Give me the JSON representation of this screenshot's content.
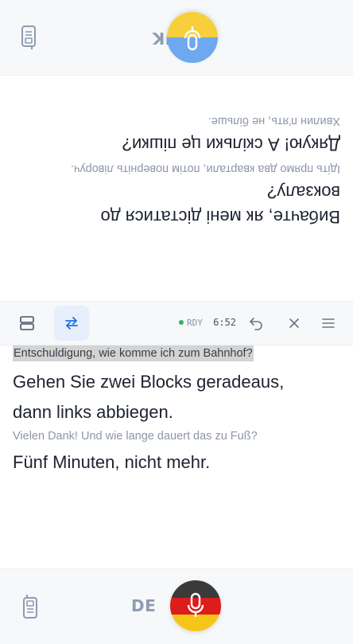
{
  "top_panel": {
    "language_code": "UK",
    "lines": [
      {
        "text": "Вибачте, як мені дістатися до",
        "style": "big"
      },
      {
        "text": "вокзалу?",
        "style": "big"
      },
      {
        "text": "Ідіть прямо два квартали, потім поверніть ліворуч.",
        "style": "small"
      },
      {
        "text": "Дякую! А скільки це пішки?",
        "style": "big"
      },
      {
        "text": "Хвилин п'ять, не більше.",
        "style": "small"
      }
    ],
    "icons": {
      "mic": "mic-icon",
      "device": "walkie-talkie-icon"
    },
    "flag_colors": [
      "#0057b7",
      "#ffd700"
    ]
  },
  "toolbar": {
    "status_label": "RDY",
    "time": "6:52",
    "status_color": "#2fb36b",
    "icons": [
      "layout-split-icon",
      "swap-icon",
      "undo-icon",
      "close-icon",
      "menu-icon"
    ]
  },
  "bottom_panel": {
    "language_code": "DE",
    "lines": [
      {
        "text": "Entschuldigung, wie komme ich zum Bahnhof?",
        "style": "highlight"
      },
      {
        "text": "Gehen Sie zwei Blocks geradeaus,",
        "style": "big"
      },
      {
        "text": "dann links abbiegen.",
        "style": "big"
      },
      {
        "text": "Vielen Dank! Und wie lange dauert das zu Fuß?",
        "style": "small"
      },
      {
        "text": "Fünf Minuten, nicht mehr.",
        "style": "big"
      }
    ],
    "icons": {
      "mic": "mic-icon",
      "device": "walkie-talkie-icon"
    },
    "flag_colors": [
      "#000000",
      "#dd0000",
      "#ffce00"
    ]
  },
  "accent_color": "#1a73e8"
}
